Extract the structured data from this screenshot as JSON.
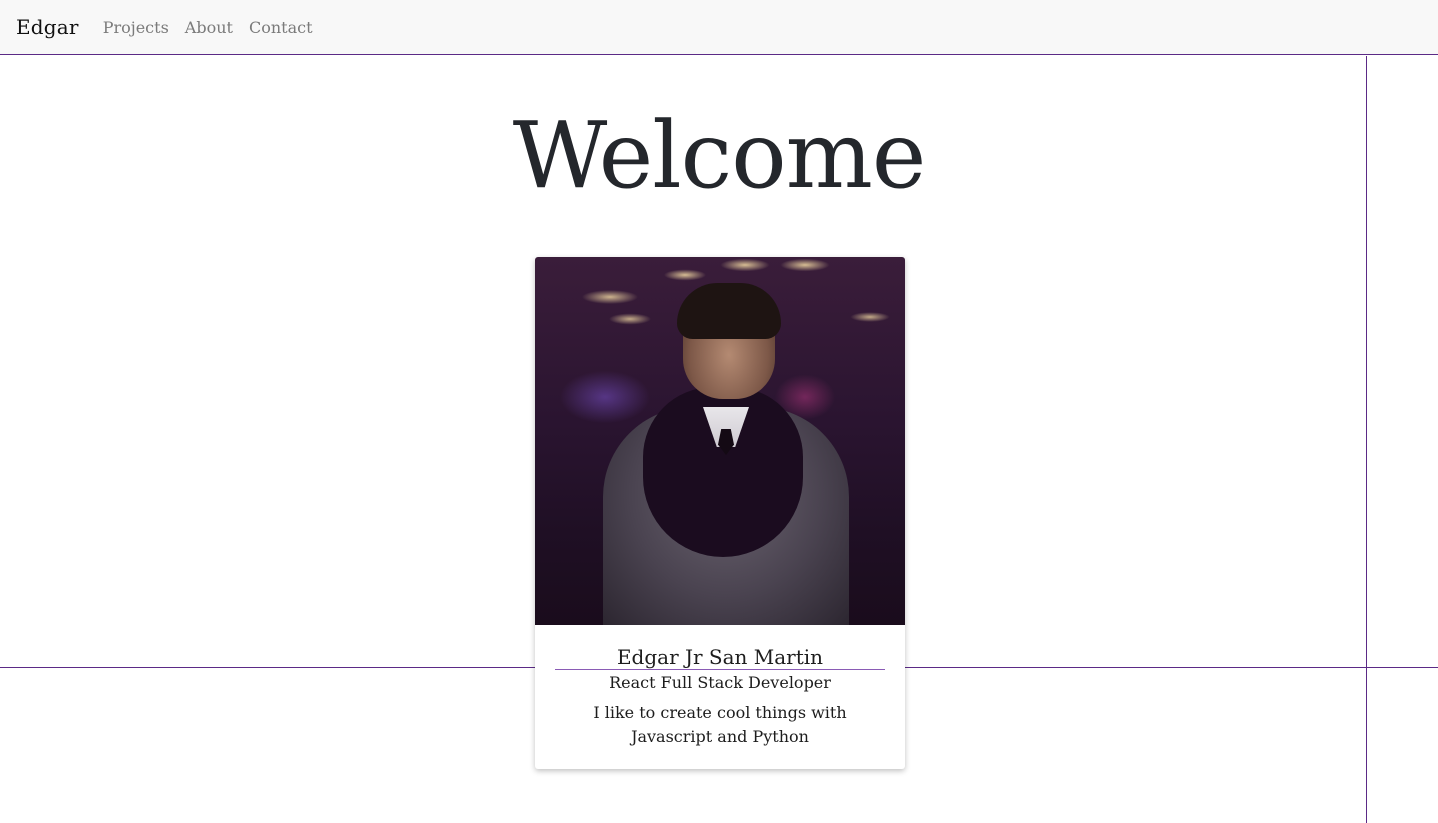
{
  "nav": {
    "brand": "Edgar",
    "links": [
      "Projects",
      "About",
      "Contact"
    ]
  },
  "hero": {
    "title": "Welcome"
  },
  "profile": {
    "name": "Edgar Jr San Martin",
    "role": "React Full Stack Developer",
    "description": "I like to create cool things with Javascript and Python"
  },
  "colors": {
    "accent": "#5b2a86",
    "navbar_bg": "#f8f8f8",
    "nav_link": "#7b7b7b",
    "text": "#212529"
  }
}
